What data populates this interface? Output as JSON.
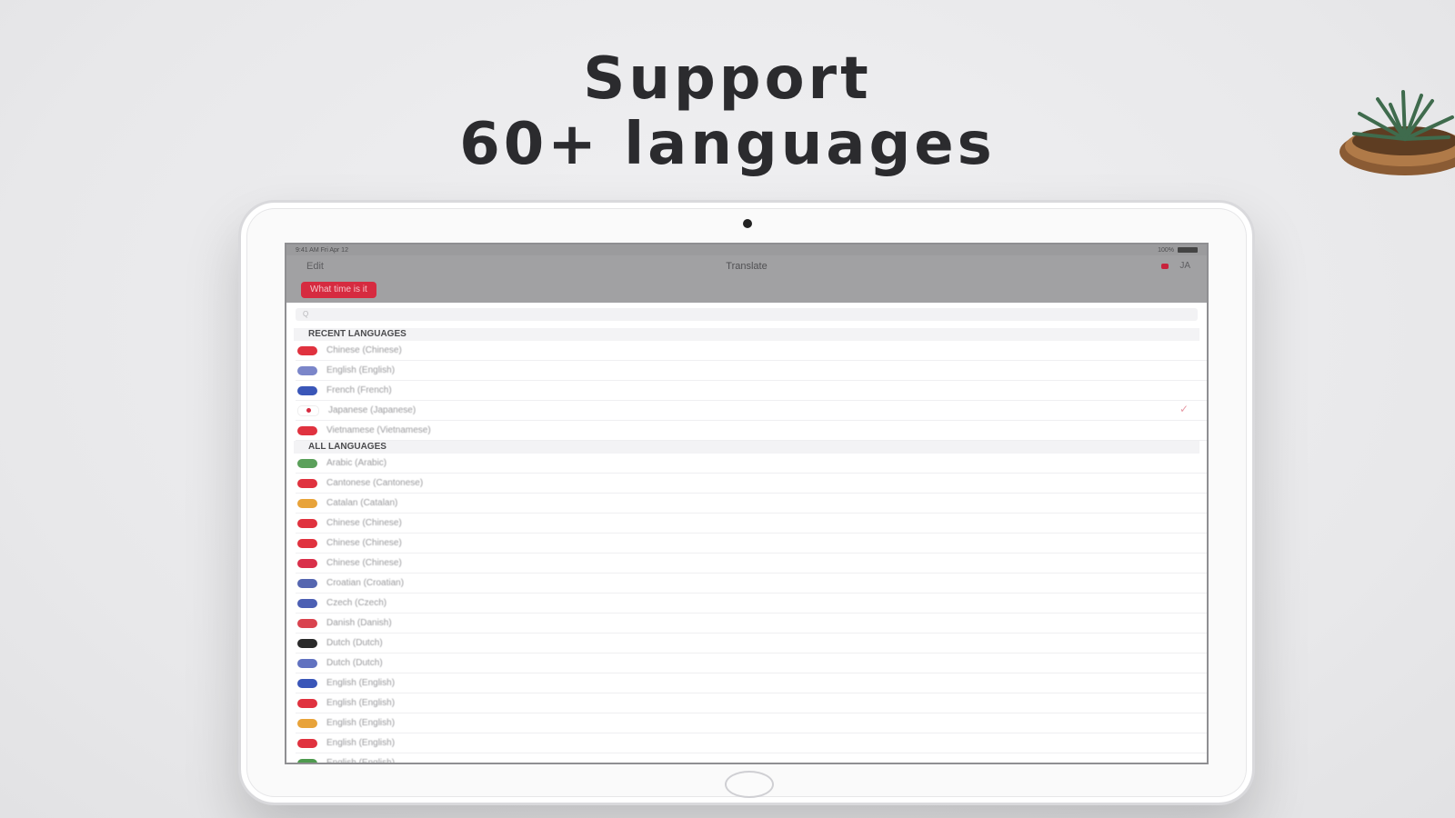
{
  "headline": {
    "line1": "Support",
    "line2": "60+ languages"
  },
  "screen": {
    "status_left": "9:41 AM   Fri Apr 12",
    "status_right": "100%",
    "nav_edit": "Edit",
    "nav_title": "Translate",
    "nav_lang": "JA",
    "pill": "What time is it",
    "search_placeholder": "Q",
    "recent_header": "RECENT LANGUAGES",
    "all_header": "ALL LANGUAGES",
    "recent": [
      {
        "label": "Chinese (Chinese)",
        "color": "#e0323f",
        "checked": false
      },
      {
        "label": "English (English)",
        "color": "#7b86c9",
        "checked": false
      },
      {
        "label": "French (French)",
        "color": "#3a56b8",
        "checked": false
      },
      {
        "label": "Japanese (Japanese)",
        "color": "#ffffff",
        "checked": true
      },
      {
        "label": "Vietnamese (Vietnamese)",
        "color": "#e0323f",
        "checked": false
      }
    ],
    "all": [
      {
        "label": "Arabic (Arabic)",
        "color": "#5aa05a"
      },
      {
        "label": "Cantonese (Cantonese)",
        "color": "#e0323f"
      },
      {
        "label": "Catalan (Catalan)",
        "color": "#e8a33a"
      },
      {
        "label": "Chinese (Chinese)",
        "color": "#e0323f"
      },
      {
        "label": "Chinese (Chinese)",
        "color": "#e0323f"
      },
      {
        "label": "Chinese (Chinese)",
        "color": "#d9304a"
      },
      {
        "label": "Croatian (Croatian)",
        "color": "#5566b0"
      },
      {
        "label": "Czech (Czech)",
        "color": "#4c5fb3"
      },
      {
        "label": "Danish (Danish)",
        "color": "#d9434f"
      },
      {
        "label": "Dutch (Dutch)",
        "color": "#2a2a2a"
      },
      {
        "label": "Dutch (Dutch)",
        "color": "#6172c0"
      },
      {
        "label": "English (English)",
        "color": "#3a56b8"
      },
      {
        "label": "English (English)",
        "color": "#e0323f"
      },
      {
        "label": "English (English)",
        "color": "#e8a33a"
      },
      {
        "label": "English (English)",
        "color": "#e0323f"
      },
      {
        "label": "English (English)",
        "color": "#4e9a4e"
      }
    ],
    "check_icon": "checkmark-icon"
  }
}
